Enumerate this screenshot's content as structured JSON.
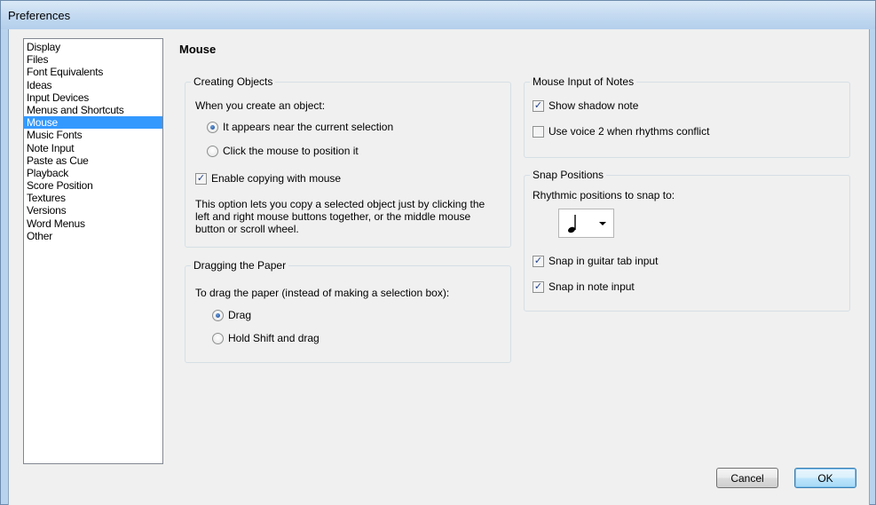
{
  "window": {
    "title": "Preferences"
  },
  "categories": [
    "Display",
    "Files",
    "Font Equivalents",
    "Ideas",
    "Input Devices",
    "Menus and Shortcuts",
    "Mouse",
    "Music Fonts",
    "Note Input",
    "Paste as Cue",
    "Playback",
    "Score Position",
    "Textures",
    "Versions",
    "Word Menus",
    "Other"
  ],
  "selected_category": "Mouse",
  "page": {
    "title": "Mouse"
  },
  "creating_objects": {
    "legend": "Creating Objects",
    "prompt": "When you create an object:",
    "option_near": "It appears near the current selection",
    "option_click": "Click the mouse to position it",
    "selected_option": "It appears near the current selection",
    "enable_copying_label": "Enable copying with mouse",
    "enable_copying_checked": true,
    "description": "This option lets you copy a selected object just by clicking the left and right mouse buttons together, or the middle mouse button or scroll wheel."
  },
  "dragging_paper": {
    "legend": "Dragging the Paper",
    "prompt": "To drag the paper (instead of making a selection box):",
    "option_drag": "Drag",
    "option_shift": "Hold Shift and drag",
    "selected_option": "Drag"
  },
  "mouse_input_notes": {
    "legend": "Mouse Input of Notes",
    "show_shadow_label": "Show shadow note",
    "show_shadow_checked": true,
    "voice2_label": "Use voice 2 when rhythms conflict",
    "voice2_checked": false
  },
  "snap_positions": {
    "legend": "Snap Positions",
    "prompt": "Rhythmic positions to snap to:",
    "note_value": "quarter-note-icon",
    "guitar_tab_label": "Snap in guitar tab input",
    "guitar_tab_checked": true,
    "note_input_label": "Snap in note input",
    "note_input_checked": true
  },
  "buttons": {
    "cancel": "Cancel",
    "ok": "OK"
  }
}
